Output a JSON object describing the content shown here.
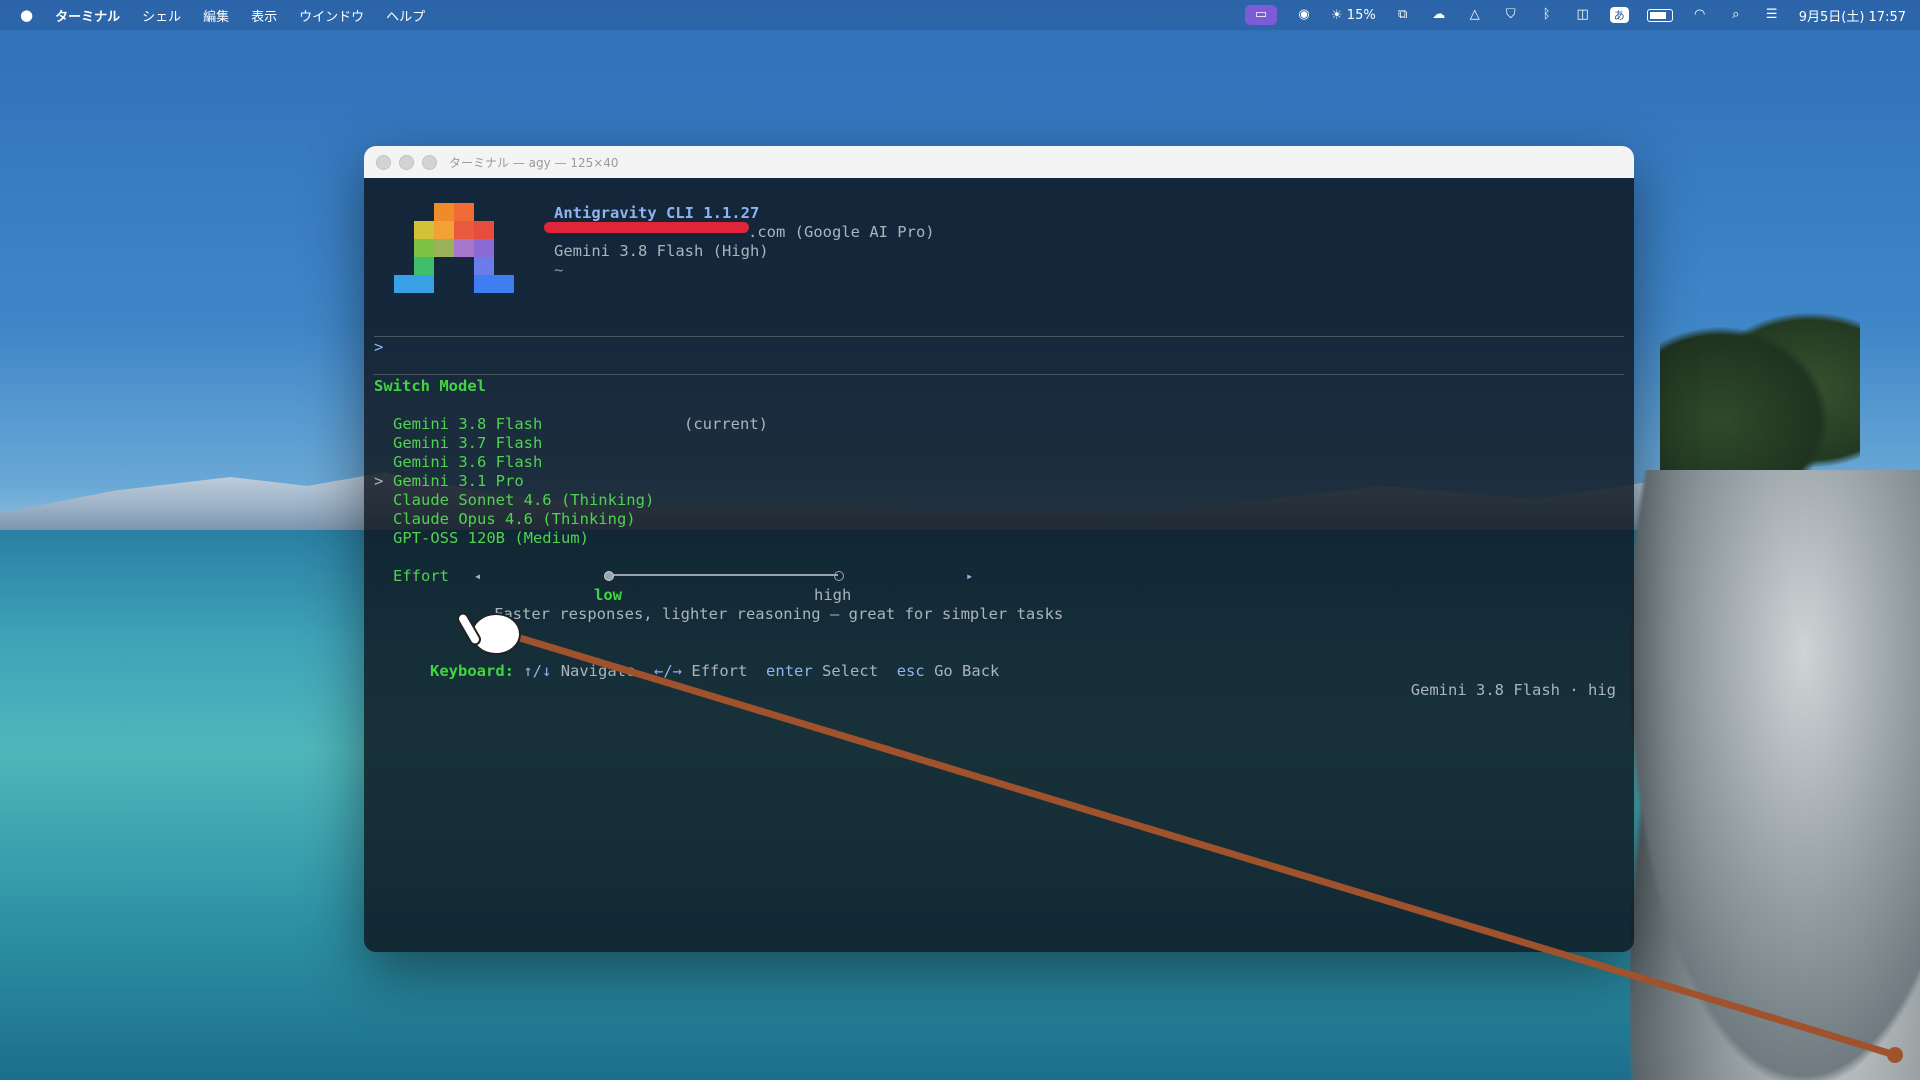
{
  "menubar": {
    "app": "ターミナル",
    "items": [
      "シェル",
      "編集",
      "表示",
      "ウインドウ",
      "ヘルプ"
    ],
    "brightness": "15%",
    "ime_badge": "あ",
    "datetime": "9月5日(土) 17:57"
  },
  "window": {
    "title": "ターミナル — agy — 125×40"
  },
  "header": {
    "app_name": "Antigravity CLI 1.1.27",
    "account_suffix": ".com (Google AI Pro)",
    "model": "Gemini 3.8 Flash (High)",
    "cwd": "~"
  },
  "prompt": {
    "symbol": ">"
  },
  "switch_model": {
    "heading": "Switch Model",
    "current_tag": "(current)",
    "pointer": ">",
    "models": [
      "Gemini 3.8 Flash",
      "Gemini 3.7 Flash",
      "Gemini 3.6 Flash",
      "Gemini 3.1 Pro",
      "Claude Sonnet 4.6 (Thinking)",
      "Claude Opus 4.6 (Thinking)",
      "GPT-OSS 120B (Medium)"
    ],
    "selected_index": 3
  },
  "effort": {
    "label": "Effort",
    "left_arrow": "◂",
    "right_arrow": "▸",
    "low_label": "low",
    "high_label": "high",
    "level": 0,
    "description": "Faster responses, lighter reasoning — great for simpler tasks"
  },
  "keyboard": {
    "label": "Keyboard:",
    "navigate_key": "↑/↓",
    "navigate_text": "Navigate",
    "effort_key": "←/→",
    "effort_text": "Effort",
    "enter_key": "enter",
    "enter_text": "Select",
    "esc_key": "esc",
    "esc_text": "Go Back"
  },
  "status": {
    "text": "Gemini 3.8 Flash · hig"
  },
  "colors": {
    "accent_green": "#3fd63f",
    "accent_blue": "#8fb4f0",
    "redaction": "#e0243a",
    "cursor_line": "#a0522d"
  },
  "icons": {
    "apple": "apple-icon",
    "cursor": "hand-pointer-icon"
  }
}
